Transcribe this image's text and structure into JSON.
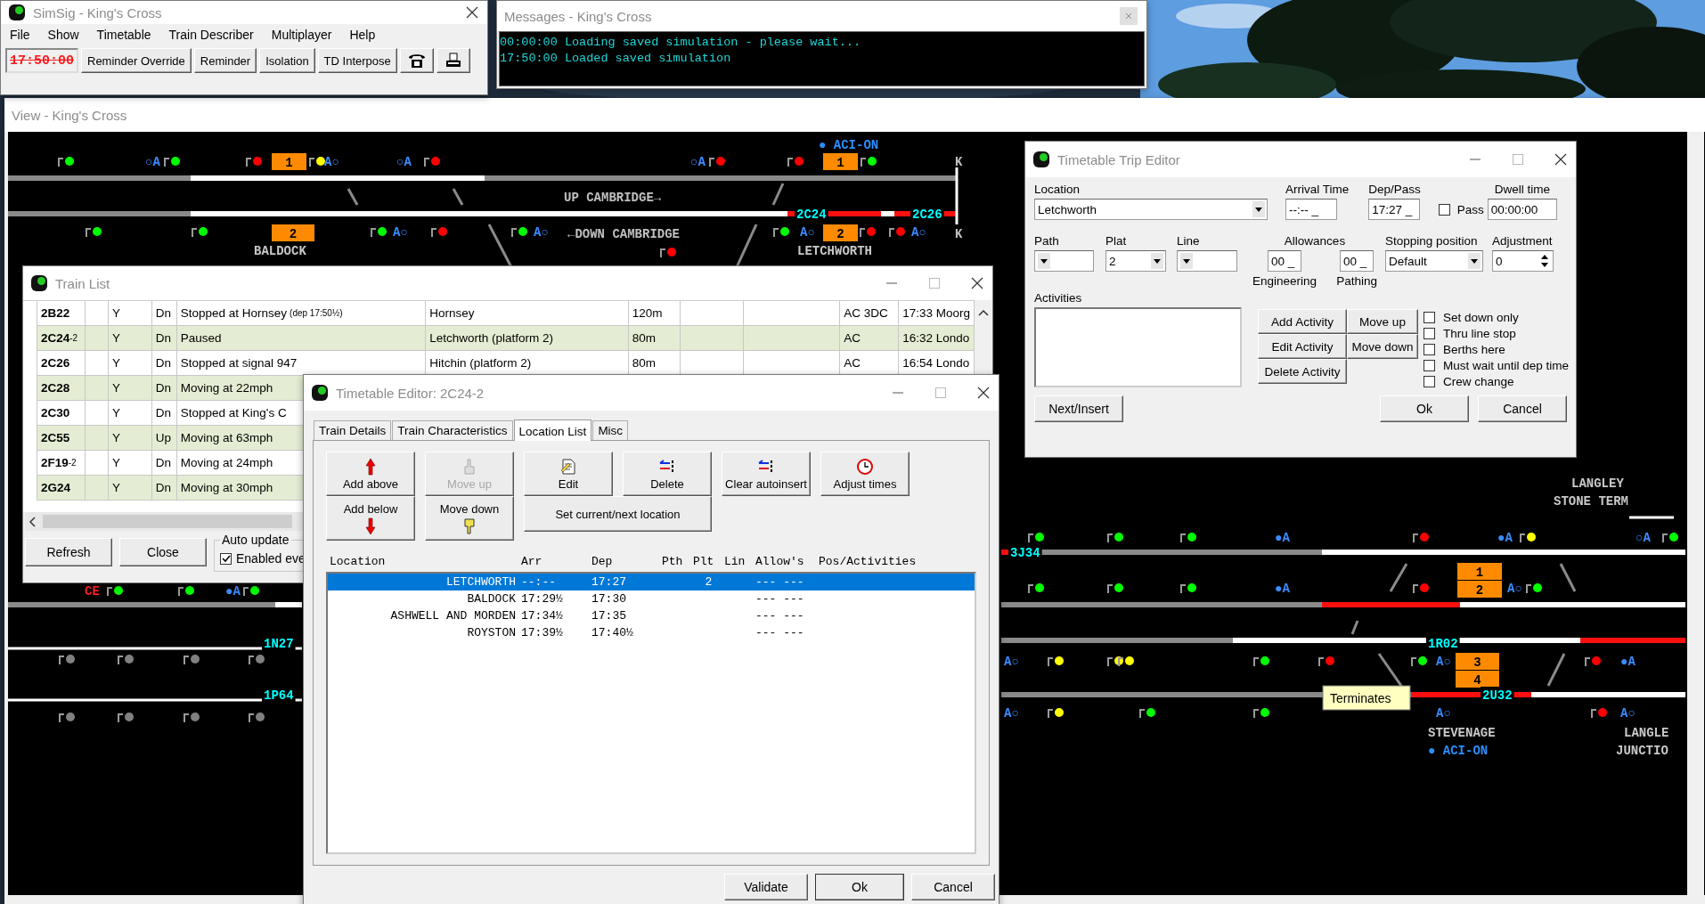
{
  "main_window": {
    "title": "SimSig - King's Cross",
    "menu": [
      "File",
      "Show",
      "Timetable",
      "Train Describer",
      "Multiplayer",
      "Help"
    ],
    "clock": {
      "text": "17:50:00",
      "paused": true
    },
    "toolbar": [
      "Reminder Override",
      "Reminder",
      "Isolation",
      "TD Interpose"
    ]
  },
  "messages_window": {
    "title": "Messages - King's Cross",
    "lines": [
      "00:00:00 Loading saved simulation - please wait...",
      "17:50:00 Loaded saved simulation"
    ]
  },
  "view_window": {
    "title": "View - King's Cross",
    "diagram": {
      "labels": [
        {
          "text": "● ACI-ON",
          "kind": "status"
        },
        {
          "text": "○A",
          "kind": "auto"
        },
        {
          "text": "1",
          "kind": "berth"
        },
        {
          "text": "A○",
          "kind": "auto"
        },
        {
          "text": "○A",
          "kind": "auto"
        },
        {
          "text": "○A",
          "kind": "auto"
        },
        {
          "text": "1",
          "kind": "berth"
        },
        {
          "text": "K",
          "kind": "limit"
        },
        {
          "text": "UP CAMBRIDGE→",
          "kind": "route"
        },
        {
          "text": "2C24",
          "kind": "describer"
        },
        {
          "text": "2C26",
          "kind": "describer"
        },
        {
          "text": "2",
          "kind": "berth"
        },
        {
          "text": "A○",
          "kind": "auto"
        },
        {
          "text": "A○",
          "kind": "auto"
        },
        {
          "text": "←DOWN CAMBRIDGE",
          "kind": "route"
        },
        {
          "text": "A○",
          "kind": "auto"
        },
        {
          "text": "2",
          "kind": "berth"
        },
        {
          "text": "A○",
          "kind": "auto"
        },
        {
          "text": "K",
          "kind": "limit"
        },
        {
          "text": "BALDOCK",
          "kind": "location"
        },
        {
          "text": "LETCHWORTH",
          "kind": "location"
        },
        {
          "text": "LANGLEY",
          "kind": "location"
        },
        {
          "text": "STONE TERM",
          "kind": "location"
        },
        {
          "text": "3J34",
          "kind": "describer"
        },
        {
          "text": "●A",
          "kind": "auto"
        },
        {
          "text": "●A",
          "kind": "auto"
        },
        {
          "text": "○A",
          "kind": "auto"
        },
        {
          "text": "1",
          "kind": "berth"
        },
        {
          "text": "●A",
          "kind": "auto"
        },
        {
          "text": "2",
          "kind": "berth"
        },
        {
          "text": "A○",
          "kind": "auto"
        },
        {
          "text": "1R02",
          "kind": "describer"
        },
        {
          "text": "A○",
          "kind": "auto"
        },
        {
          "text": "A○",
          "kind": "auto"
        },
        {
          "text": "3",
          "kind": "berth"
        },
        {
          "text": "4",
          "kind": "berth"
        },
        {
          "text": "●A",
          "kind": "auto"
        },
        {
          "text": "2U32",
          "kind": "describer"
        },
        {
          "text": "A○",
          "kind": "auto"
        },
        {
          "text": "A○",
          "kind": "auto"
        },
        {
          "text": "A○",
          "kind": "auto"
        },
        {
          "text": "STEVENAGE",
          "kind": "location"
        },
        {
          "text": "● ACI-ON",
          "kind": "status"
        },
        {
          "text": "LANGLE",
          "kind": "location"
        },
        {
          "text": "JUNCTIO",
          "kind": "location"
        },
        {
          "text": "CE",
          "kind": "warning"
        },
        {
          "text": "●A",
          "kind": "auto"
        },
        {
          "text": "1N27",
          "kind": "describer"
        },
        {
          "text": "1P64",
          "kind": "describer"
        }
      ],
      "signals": [
        {
          "color": "#00ff00"
        },
        {
          "color": "#00ff00"
        },
        {
          "color": "#ff0000"
        },
        {
          "color": "#ffff00"
        },
        {
          "color": "#ff0000"
        },
        {
          "color": "#ff0000"
        },
        {
          "color": "#00ff00"
        },
        {
          "color": "#00ff00"
        },
        {
          "color": "#00ff00"
        },
        {
          "color": "#00ff00"
        },
        {
          "color": "#00ff00"
        },
        {
          "color": "#00ff00"
        },
        {
          "color": "#ff0000"
        },
        {
          "color": "#ff0000"
        },
        {
          "color": "#ff0000"
        },
        {
          "color": "#ff0000"
        },
        {
          "color": "#ff0000"
        },
        {
          "color": "#00ff00"
        },
        {
          "color": "#00ff00"
        },
        {
          "color": "#00ff00"
        },
        {
          "color": "#ff0000"
        },
        {
          "color": "#ffff00"
        },
        {
          "color": "#00ff00"
        },
        {
          "color": "#00ff00"
        },
        {
          "color": "#00ff00"
        },
        {
          "color": "#00ff00"
        },
        {
          "color": "#ff0000"
        },
        {
          "color": "#00ff00"
        },
        {
          "color": "#ffff00"
        },
        {
          "color": "#ffff00"
        },
        {
          "color": "#ffff00"
        },
        {
          "color": "#00ff00"
        },
        {
          "color": "#ff0000"
        },
        {
          "color": "#00ff00"
        },
        {
          "color": "#ff0000"
        },
        {
          "color": "#ffff00"
        },
        {
          "color": "#00ff00"
        },
        {
          "color": "#00ff00"
        },
        {
          "color": "#ff0000"
        },
        {
          "color": "#00ff00"
        },
        {
          "color": "#00ff00"
        },
        {
          "color": "#00ff00"
        },
        {
          "color": "#808080"
        },
        {
          "color": "#808080"
        },
        {
          "color": "#808080"
        },
        {
          "color": "#808080"
        },
        {
          "color": "#808080"
        },
        {
          "color": "#808080"
        },
        {
          "color": "#808080"
        },
        {
          "color": "#808080"
        }
      ],
      "tooltip": "Terminates"
    }
  },
  "train_list": {
    "title": "Train List",
    "rows": [
      {
        "headcode": "2B22",
        "column_3": "Y",
        "direction": "Dn",
        "status": "Stopped at Hornsey",
        "status_note": "(dep 17:50½)",
        "location": "Hornsey",
        "length": "120m",
        "power": "AC 3DC",
        "column_11": "17:33 Moorg"
      },
      {
        "headcode": "2C24",
        "suffix": "-2",
        "column_3": "Y",
        "direction": "Dn",
        "status": "Paused",
        "location": "Letchworth (platform 2)",
        "length": "80m",
        "power": "AC",
        "column_11": "16:32 Londo"
      },
      {
        "headcode": "2C26",
        "column_3": "Y",
        "direction": "Dn",
        "status": "Stopped at signal 947",
        "location": "Hitchin (platform 2)",
        "length": "80m",
        "power": "AC",
        "column_11": "16:54 Londo"
      },
      {
        "headcode": "2C28",
        "column_3": "Y",
        "direction": "Dn",
        "status": "Moving at 22mph"
      },
      {
        "headcode": "2C30",
        "column_3": "Y",
        "direction": "Dn",
        "status": "Stopped at King's C"
      },
      {
        "headcode": "2C55",
        "column_3": "Y",
        "direction": "Up",
        "status": "Moving at 63mph"
      },
      {
        "headcode": "2F19",
        "suffix": "-2",
        "column_3": "Y",
        "direction": "Dn",
        "status": "Moving at 24mph"
      },
      {
        "headcode": "2G24",
        "column_3": "Y",
        "direction": "Dn",
        "status": "Moving at 30mph"
      }
    ],
    "buttons": [
      "Refresh",
      "Close"
    ],
    "auto_update": {
      "label": "Auto update",
      "option": {
        "label": "Enabled eve",
        "checked": true
      }
    }
  },
  "timetable_editor": {
    "title": "Timetable Editor: 2C24-2",
    "tabs": [
      {
        "label": "Train Details",
        "selected": false
      },
      {
        "label": "Train Characteristics",
        "selected": false
      },
      {
        "label": "Location List",
        "selected": true
      },
      {
        "label": "Misc",
        "selected": false
      }
    ],
    "actions": [
      {
        "label": "Add above",
        "kind": "up-arrow",
        "disabled": false
      },
      {
        "label": "Move up",
        "kind": "hand-up",
        "disabled": true
      },
      {
        "label": "Edit",
        "kind": "edit",
        "disabled": false
      },
      {
        "label": "Delete",
        "kind": "swap",
        "disabled": false
      },
      {
        "label": "Clear autoinsert",
        "kind": "swap",
        "disabled": false
      },
      {
        "label": "Adjust times",
        "kind": "clock",
        "disabled": false
      },
      {
        "label": "Add below",
        "kind": "down-arrow",
        "disabled": false
      },
      {
        "label": "Move down",
        "kind": "hand-down",
        "disabled": false
      },
      {
        "label": "Set current/next location",
        "kind": "plain",
        "disabled": false
      }
    ],
    "columns": [
      "Location",
      "Arr",
      "Dep",
      "Pth",
      "Plt",
      "Lin",
      "Allow's",
      "Pos/Activities"
    ],
    "rows": [
      {
        "location": "LETCHWORTH",
        "arr": "--:--",
        "dep": "17:27",
        "plt": "2",
        "allow": "--- ---",
        "selected": true
      },
      {
        "location": "BALDOCK",
        "arr": "17:29½",
        "dep": "17:30",
        "allow": "--- ---",
        "selected": false
      },
      {
        "location": "ASHWELL AND MORDEN",
        "arr": "17:34½",
        "dep": "17:35",
        "allow": "--- ---",
        "selected": false
      },
      {
        "location": "ROYSTON",
        "arr": "17:39½",
        "dep": "17:40½",
        "allow": "--- ---",
        "selected": false
      }
    ],
    "buttons": [
      "Validate",
      "Ok",
      "Cancel"
    ]
  },
  "trip_editor": {
    "title": "Timetable Trip Editor",
    "location": {
      "label": "Location",
      "value": "Letchworth"
    },
    "arrival": {
      "label": "Arrival Time",
      "value": "--:-- _"
    },
    "dep_pass": {
      "label": "Dep/Pass",
      "value": "17:27 _"
    },
    "pass": {
      "label": "Pass",
      "checked": false
    },
    "dwell": {
      "label": "Dwell time",
      "value": "00:00:00"
    },
    "path": {
      "label": "Path"
    },
    "plat": {
      "label": "Plat",
      "value": "2"
    },
    "line": {
      "label": "Line"
    },
    "allowances": {
      "label": "Allowances",
      "engineering": {
        "label": "Engineering",
        "value": "00 _"
      },
      "pathing": {
        "label": "Pathing",
        "value": "00 _"
      }
    },
    "stopping_position": {
      "label": "Stopping position",
      "value": "Default"
    },
    "adjustment": {
      "label": "Adjustment",
      "value": "0"
    },
    "activities": {
      "label": "Activities"
    },
    "activity_buttons": [
      "Add Activity",
      "Move up",
      "Edit Activity",
      "Move down",
      "Delete Activity"
    ],
    "options": [
      {
        "label": "Set down only",
        "checked": false
      },
      {
        "label": "Thru line stop",
        "checked": false
      },
      {
        "label": "Berths here",
        "checked": false
      },
      {
        "label": "Must wait until dep time",
        "checked": false
      },
      {
        "label": "Crew change",
        "checked": false
      }
    ],
    "buttons": [
      "Next/Insert",
      "Ok",
      "Cancel"
    ]
  }
}
